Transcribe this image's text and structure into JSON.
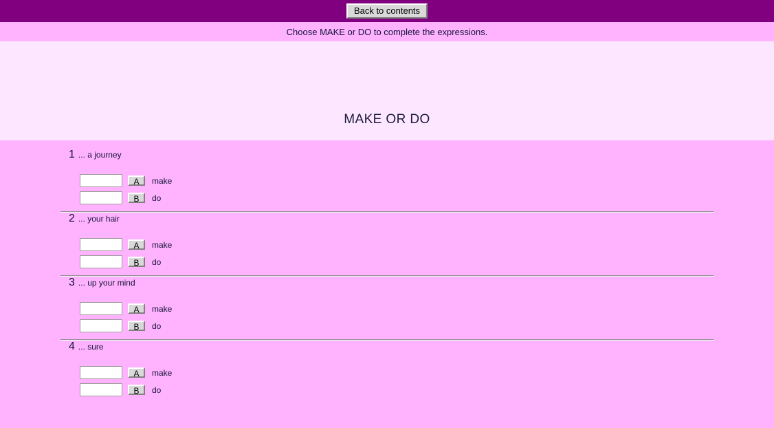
{
  "header": {
    "back_button_label": "Back to contents",
    "bar_color": "#800080"
  },
  "instruction": {
    "text": "Choose MAKE or DO to complete the expressions.",
    "bar_color": "#ffb3ff"
  },
  "title_zone": {
    "title": "MAKE OR DO",
    "background_color": "#fde6ff"
  },
  "content": {
    "background_color": "#ffb3ff",
    "input_value": "",
    "questions": [
      {
        "number": "1",
        "prompt": "... a journey",
        "options": [
          {
            "letter": "A",
            "label": "make",
            "value": ""
          },
          {
            "letter": "B",
            "label": "do",
            "value": ""
          }
        ]
      },
      {
        "number": "2",
        "prompt": "... your hair",
        "options": [
          {
            "letter": "A",
            "label": "make",
            "value": ""
          },
          {
            "letter": "B",
            "label": "do",
            "value": ""
          }
        ]
      },
      {
        "number": "3",
        "prompt": "... up your mind",
        "options": [
          {
            "letter": "A",
            "label": "make",
            "value": ""
          },
          {
            "letter": "B",
            "label": "do",
            "value": ""
          }
        ]
      },
      {
        "number": "4",
        "prompt": "... sure",
        "options": [
          {
            "letter": "A",
            "label": "make",
            "value": ""
          },
          {
            "letter": "B",
            "label": "do",
            "value": ""
          }
        ]
      }
    ]
  }
}
